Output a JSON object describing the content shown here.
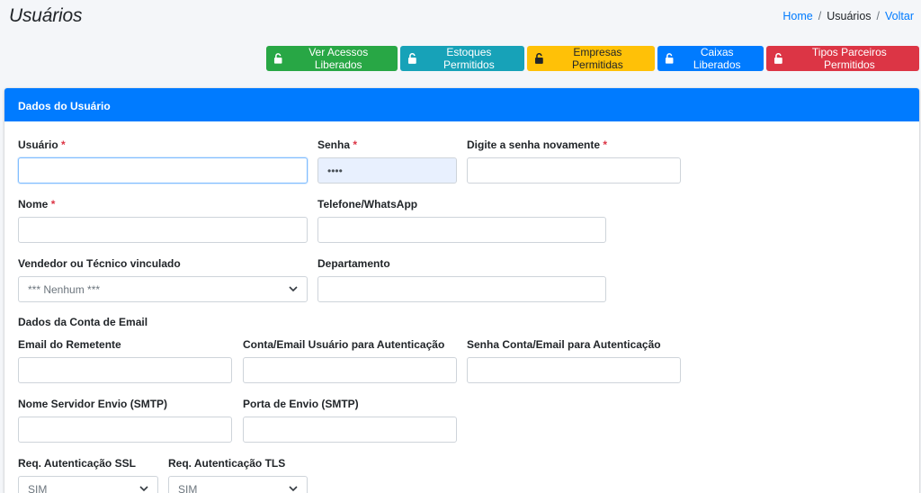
{
  "header": {
    "title": "Usuários",
    "breadcrumb": {
      "home": "Home",
      "current": "Usuários",
      "back": "Voltar",
      "separator": "/"
    }
  },
  "actions": {
    "ver_acessos": "Ver Acessos Liberados",
    "estoques": "Estoques Permitidos",
    "empresas": "Empresas Permitidas",
    "caixas": "Caixas Liberados",
    "tipos_parceiros": "Tipos Parceiros Permitidos",
    "colors": {
      "green": "#28a745",
      "teal": "#17a2b8",
      "yellow": "#ffc107",
      "blue": "#007bff",
      "red": "#dc3545"
    }
  },
  "card": {
    "title": "Dados do Usuário",
    "required_mark": "*",
    "fields": {
      "usuario": {
        "label": "Usuário",
        "value": ""
      },
      "senha": {
        "label": "Senha",
        "value": "••••"
      },
      "senha_confirm": {
        "label": "Digite a senha novamente",
        "value": ""
      },
      "nome": {
        "label": "Nome",
        "value": ""
      },
      "telefone": {
        "label": "Telefone/WhatsApp",
        "value": ""
      },
      "vendedor": {
        "label": "Vendedor ou Técnico vinculado",
        "selected": "*** Nenhum ***"
      },
      "departamento": {
        "label": "Departamento",
        "value": ""
      }
    },
    "email_section": {
      "title": "Dados da Conta de Email",
      "remetente": {
        "label": "Email do Remetente",
        "value": ""
      },
      "conta_auth": {
        "label": "Conta/Email Usuário para Autenticação",
        "value": ""
      },
      "senha_auth": {
        "label": "Senha Conta/Email para Autenticação",
        "value": ""
      },
      "smtp_server": {
        "label": "Nome Servidor Envio (SMTP)",
        "value": ""
      },
      "smtp_port": {
        "label": "Porta de Envio (SMTP)",
        "value": ""
      },
      "ssl": {
        "label": "Req. Autenticação SSL",
        "selected": "SIM"
      },
      "tls": {
        "label": "Req. Autenticação TLS",
        "selected": "SIM"
      }
    }
  }
}
